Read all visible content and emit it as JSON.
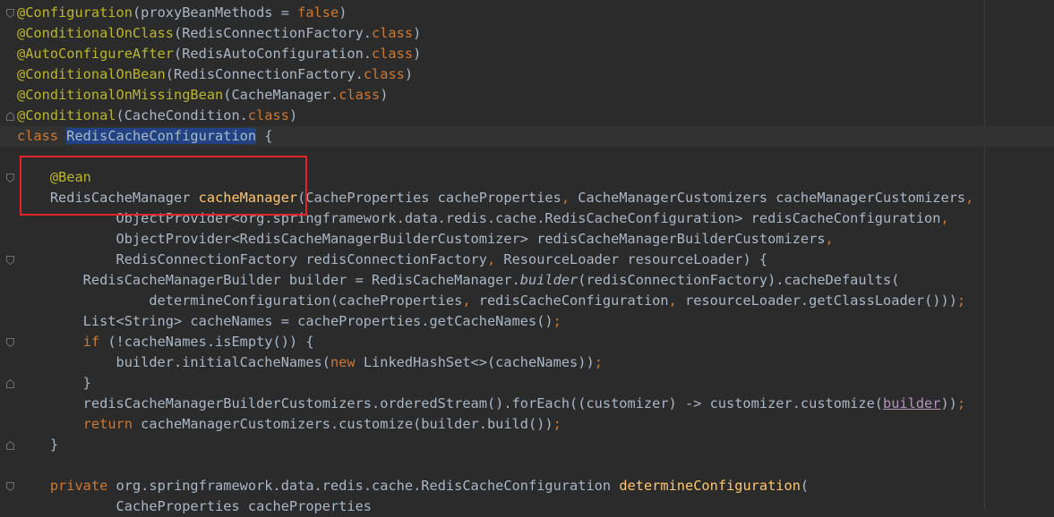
{
  "editor": {
    "lines": [
      {
        "fold": "open",
        "tokens": [
          {
            "t": "@Configuration",
            "c": "ann"
          },
          {
            "t": "(proxyBeanMethods = ",
            "c": ""
          },
          {
            "t": "false",
            "c": "kw"
          },
          {
            "t": ")",
            "c": ""
          }
        ]
      },
      {
        "tokens": [
          {
            "t": "@ConditionalOnClass",
            "c": "ann"
          },
          {
            "t": "(RedisConnectionFactory.",
            "c": ""
          },
          {
            "t": "class",
            "c": "kw"
          },
          {
            "t": ")",
            "c": ""
          }
        ]
      },
      {
        "tokens": [
          {
            "t": "@AutoConfigureAfter",
            "c": "ann"
          },
          {
            "t": "(RedisAutoConfiguration.",
            "c": ""
          },
          {
            "t": "class",
            "c": "kw"
          },
          {
            "t": ")",
            "c": ""
          }
        ]
      },
      {
        "tokens": [
          {
            "t": "@ConditionalOnBean",
            "c": "ann"
          },
          {
            "t": "(RedisConnectionFactory.",
            "c": ""
          },
          {
            "t": "class",
            "c": "kw"
          },
          {
            "t": ")",
            "c": ""
          }
        ]
      },
      {
        "tokens": [
          {
            "t": "@ConditionalOnMissingBean",
            "c": "ann"
          },
          {
            "t": "(CacheManager.",
            "c": ""
          },
          {
            "t": "class",
            "c": "kw"
          },
          {
            "t": ")",
            "c": ""
          }
        ]
      },
      {
        "fold": "close",
        "tokens": [
          {
            "t": "@Conditional",
            "c": "ann"
          },
          {
            "t": "(CacheCondition.",
            "c": ""
          },
          {
            "t": "class",
            "c": "kw"
          },
          {
            "t": ")",
            "c": ""
          }
        ]
      },
      {
        "current": true,
        "tokens": [
          {
            "t": "class ",
            "c": "kw"
          },
          {
            "t": "RedisCacheConfiguration",
            "c": "hl"
          },
          {
            "t": " {",
            "c": ""
          }
        ]
      },
      {
        "tokens": []
      },
      {
        "fold": "open",
        "tokens": [
          {
            "t": "    ",
            "c": ""
          },
          {
            "t": "@Bean",
            "c": "ann"
          }
        ]
      },
      {
        "tokens": [
          {
            "t": "    RedisCacheManager ",
            "c": ""
          },
          {
            "t": "cacheManager",
            "c": "fn"
          },
          {
            "t": "(CacheProperties cacheProperties",
            "c": ""
          },
          {
            "t": ", ",
            "c": "kw"
          },
          {
            "t": "CacheManagerCustomizers cacheManagerCustomizers",
            "c": ""
          },
          {
            "t": ",",
            "c": "kw"
          }
        ]
      },
      {
        "tokens": [
          {
            "t": "            ObjectProvider<org.springframework.data.redis.cache.RedisCacheConfiguration> redisCacheConfiguration",
            "c": ""
          },
          {
            "t": ",",
            "c": "kw"
          }
        ]
      },
      {
        "tokens": [
          {
            "t": "            ObjectProvider<RedisCacheManagerBuilderCustomizer> redisCacheManagerBuilderCustomizers",
            "c": ""
          },
          {
            "t": ",",
            "c": "kw"
          }
        ]
      },
      {
        "fold": "open",
        "tokens": [
          {
            "t": "            RedisConnectionFactory redisConnectionFactory",
            "c": ""
          },
          {
            "t": ", ",
            "c": "kw"
          },
          {
            "t": "ResourceLoader resourceLoader) {",
            "c": ""
          }
        ]
      },
      {
        "tokens": [
          {
            "t": "        RedisCacheManagerBuilder builder = RedisCacheManager.",
            "c": ""
          },
          {
            "t": "builder",
            "c": "it"
          },
          {
            "t": "(redisConnectionFactory).cacheDefaults(",
            "c": ""
          }
        ]
      },
      {
        "tokens": [
          {
            "t": "                determineConfiguration(cacheProperties",
            "c": ""
          },
          {
            "t": ", ",
            "c": "kw"
          },
          {
            "t": "redisCacheConfiguration",
            "c": ""
          },
          {
            "t": ", ",
            "c": "kw"
          },
          {
            "t": "resourceLoader.getClassLoader()))",
            "c": ""
          },
          {
            "t": ";",
            "c": "kw"
          }
        ]
      },
      {
        "tokens": [
          {
            "t": "        List<String> cacheNames = cacheProperties.getCacheNames()",
            "c": ""
          },
          {
            "t": ";",
            "c": "kw"
          }
        ]
      },
      {
        "fold": "open",
        "tokens": [
          {
            "t": "        ",
            "c": ""
          },
          {
            "t": "if ",
            "c": "kw"
          },
          {
            "t": "(!cacheNames.isEmpty()) {",
            "c": ""
          }
        ]
      },
      {
        "tokens": [
          {
            "t": "            builder.initialCacheNames(",
            "c": ""
          },
          {
            "t": "new ",
            "c": "kw"
          },
          {
            "t": "LinkedHashSet<>(cacheNames))",
            "c": ""
          },
          {
            "t": ";",
            "c": "kw"
          }
        ]
      },
      {
        "fold": "close",
        "tokens": [
          {
            "t": "        }",
            "c": ""
          }
        ]
      },
      {
        "tokens": [
          {
            "t": "        redisCacheManagerBuilderCustomizers.orderedStream().forEach((customizer) -> customizer.customize(",
            "c": ""
          },
          {
            "t": "builder",
            "c": "ul"
          },
          {
            "t": "))",
            "c": ""
          },
          {
            "t": ";",
            "c": "kw"
          }
        ]
      },
      {
        "tokens": [
          {
            "t": "        ",
            "c": ""
          },
          {
            "t": "return ",
            "c": "kw"
          },
          {
            "t": "cacheManagerCustomizers.customize(builder.build())",
            "c": ""
          },
          {
            "t": ";",
            "c": "kw"
          }
        ]
      },
      {
        "fold": "close",
        "tokens": [
          {
            "t": "    }",
            "c": ""
          }
        ]
      },
      {
        "tokens": []
      },
      {
        "fold": "open",
        "tokens": [
          {
            "t": "    ",
            "c": ""
          },
          {
            "t": "private ",
            "c": "kw"
          },
          {
            "t": "org.springframework.data.redis.cache.RedisCacheConfiguration ",
            "c": ""
          },
          {
            "t": "determineConfiguration",
            "c": "fn"
          },
          {
            "t": "(",
            "c": ""
          }
        ]
      },
      {
        "tokens": [
          {
            "t": "            CacheProperties cacheProperties",
            "c": ""
          }
        ]
      }
    ]
  },
  "colors": {
    "background": "#2b2b2b",
    "text": "#a9b7c6",
    "keyword": "#cc7832",
    "annotation": "#bbb529",
    "method": "#ffc66d",
    "selection": "#214283",
    "highlight_box": "#e5222a"
  },
  "icons": {
    "fold_open": "fold-open-icon",
    "fold_close": "fold-close-icon"
  }
}
